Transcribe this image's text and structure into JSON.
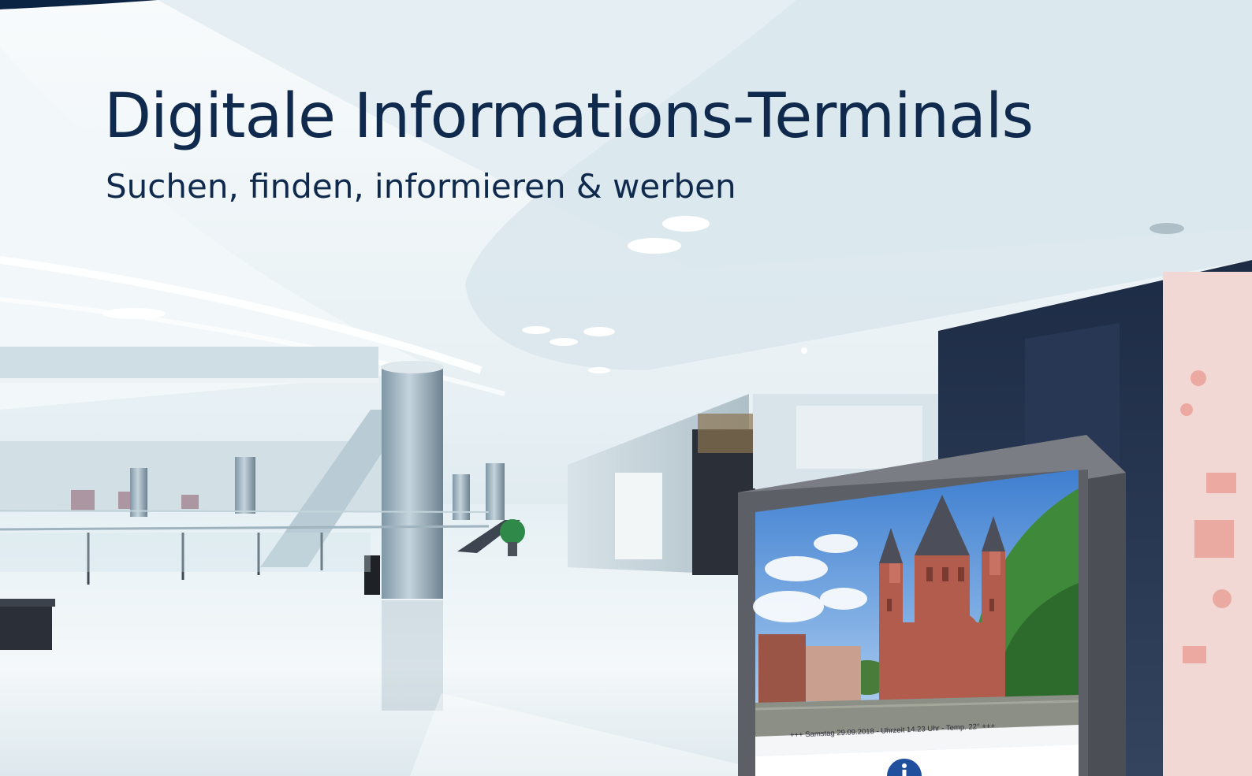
{
  "page": {
    "title": "Digitale Informations-Terminals",
    "subtitle": "Suchen, finden, informieren & werben"
  },
  "terminal": {
    "ticker_text": "+++ Samstag 29.09.2018 - Uhrzeit 14.23 Uhr - Temp. 22° +++",
    "info_icon": "info-icon"
  },
  "colors": {
    "heading": "#0f2a4d",
    "terminal_frame": "#5c5f66",
    "info_icon": "#1f4f9d",
    "top_band": "#0c2444"
  }
}
